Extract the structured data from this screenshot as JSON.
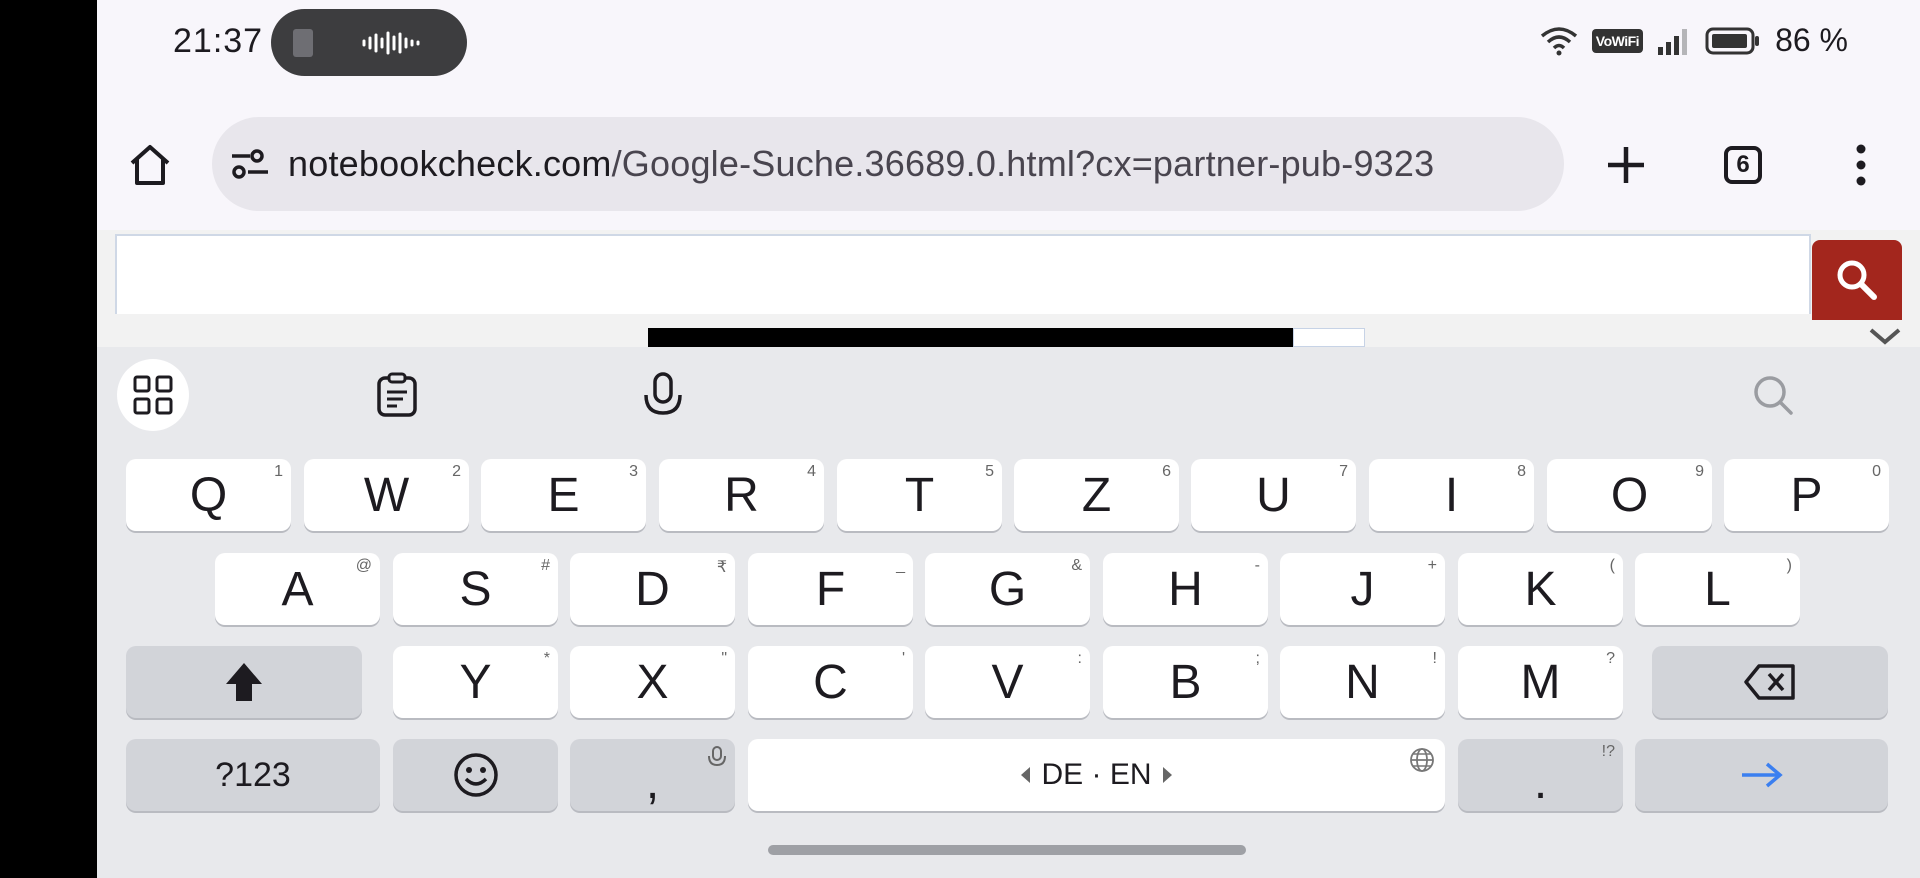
{
  "status_bar": {
    "time": "21:37",
    "vowifi_label": "VoWiFi",
    "battery_percent": "86 %"
  },
  "toolbar": {
    "url_host": "notebookcheck.com",
    "url_path": "/Google-Suche.36689.0.html?cx=partner-pub-9323",
    "tab_count": "6"
  },
  "keyboard": {
    "row1": [
      {
        "label": "Q",
        "hint": "1"
      },
      {
        "label": "W",
        "hint": "2"
      },
      {
        "label": "E",
        "hint": "3"
      },
      {
        "label": "R",
        "hint": "4"
      },
      {
        "label": "T",
        "hint": "5"
      },
      {
        "label": "Z",
        "hint": "6"
      },
      {
        "label": "U",
        "hint": "7"
      },
      {
        "label": "I",
        "hint": "8"
      },
      {
        "label": "O",
        "hint": "9"
      },
      {
        "label": "P",
        "hint": "0"
      }
    ],
    "row2": [
      {
        "label": "A",
        "hint": "@"
      },
      {
        "label": "S",
        "hint": "#"
      },
      {
        "label": "D",
        "hint": "₹"
      },
      {
        "label": "F",
        "hint": "_"
      },
      {
        "label": "G",
        "hint": "&"
      },
      {
        "label": "H",
        "hint": "-"
      },
      {
        "label": "J",
        "hint": "+"
      },
      {
        "label": "K",
        "hint": "("
      },
      {
        "label": "L",
        "hint": ")"
      }
    ],
    "row3": [
      {
        "label": "Y",
        "hint": "*"
      },
      {
        "label": "X",
        "hint": "\""
      },
      {
        "label": "C",
        "hint": "'"
      },
      {
        "label": "V",
        "hint": ":"
      },
      {
        "label": "B",
        "hint": ";"
      },
      {
        "label": "N",
        "hint": "!"
      },
      {
        "label": "M",
        "hint": "?"
      }
    ],
    "symbols_label": "?123",
    "comma_label": ",",
    "space_label": "DE · EN",
    "period_label": ".",
    "period_hint": "!?"
  },
  "colors": {
    "search_button": "#a3261d",
    "enter_arrow": "#3b7ff0"
  }
}
